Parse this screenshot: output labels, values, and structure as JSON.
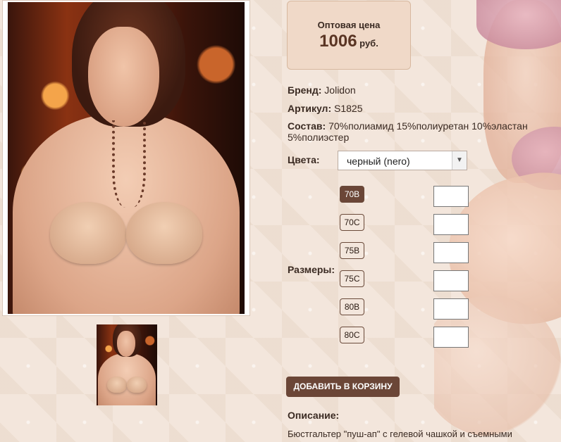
{
  "price": {
    "label": "Оптовая цена",
    "value": "1006",
    "currency": "руб."
  },
  "product": {
    "brand_label": "Бренд:",
    "brand": "Jolidon",
    "article_label": "Артикул:",
    "article": "S1825",
    "composition_label": "Состав:",
    "composition": "70%полиамид 15%полиуретан 10%эластан 5%полиэстер"
  },
  "colors": {
    "label": "Цвета:",
    "selected": "черный (nero)"
  },
  "sizes": {
    "label": "Размеры:",
    "items": [
      "70B",
      "70C",
      "75B",
      "75C",
      "80B",
      "80C"
    ],
    "active": "70B"
  },
  "cart": {
    "add_label": "ДОБАВИТЬ В КОРЗИНУ"
  },
  "description": {
    "title": "Описание:",
    "text": "Бюстгальтер \"пуш-ап\" с гелевой чашкой и съемными"
  },
  "icons": {
    "select_arrow": "chevron-down-icon"
  }
}
